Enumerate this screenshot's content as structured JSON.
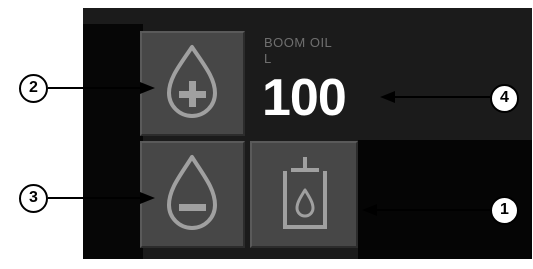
{
  "readout": {
    "name": "BOOM OIL",
    "unit": "L",
    "value": "100"
  },
  "buttons": {
    "add": {
      "icon": "oil-drop-plus-icon"
    },
    "remove": {
      "icon": "oil-drop-minus-icon"
    },
    "fill": {
      "icon": "oil-container-fill-icon"
    }
  },
  "callouts": [
    "1",
    "2",
    "3",
    "4"
  ],
  "colors": {
    "panel": "#1b1b1b",
    "button": "#474747",
    "icon": "#a0a0a0",
    "value_text": "#ffffff",
    "label_text": "#6f6f6f"
  }
}
